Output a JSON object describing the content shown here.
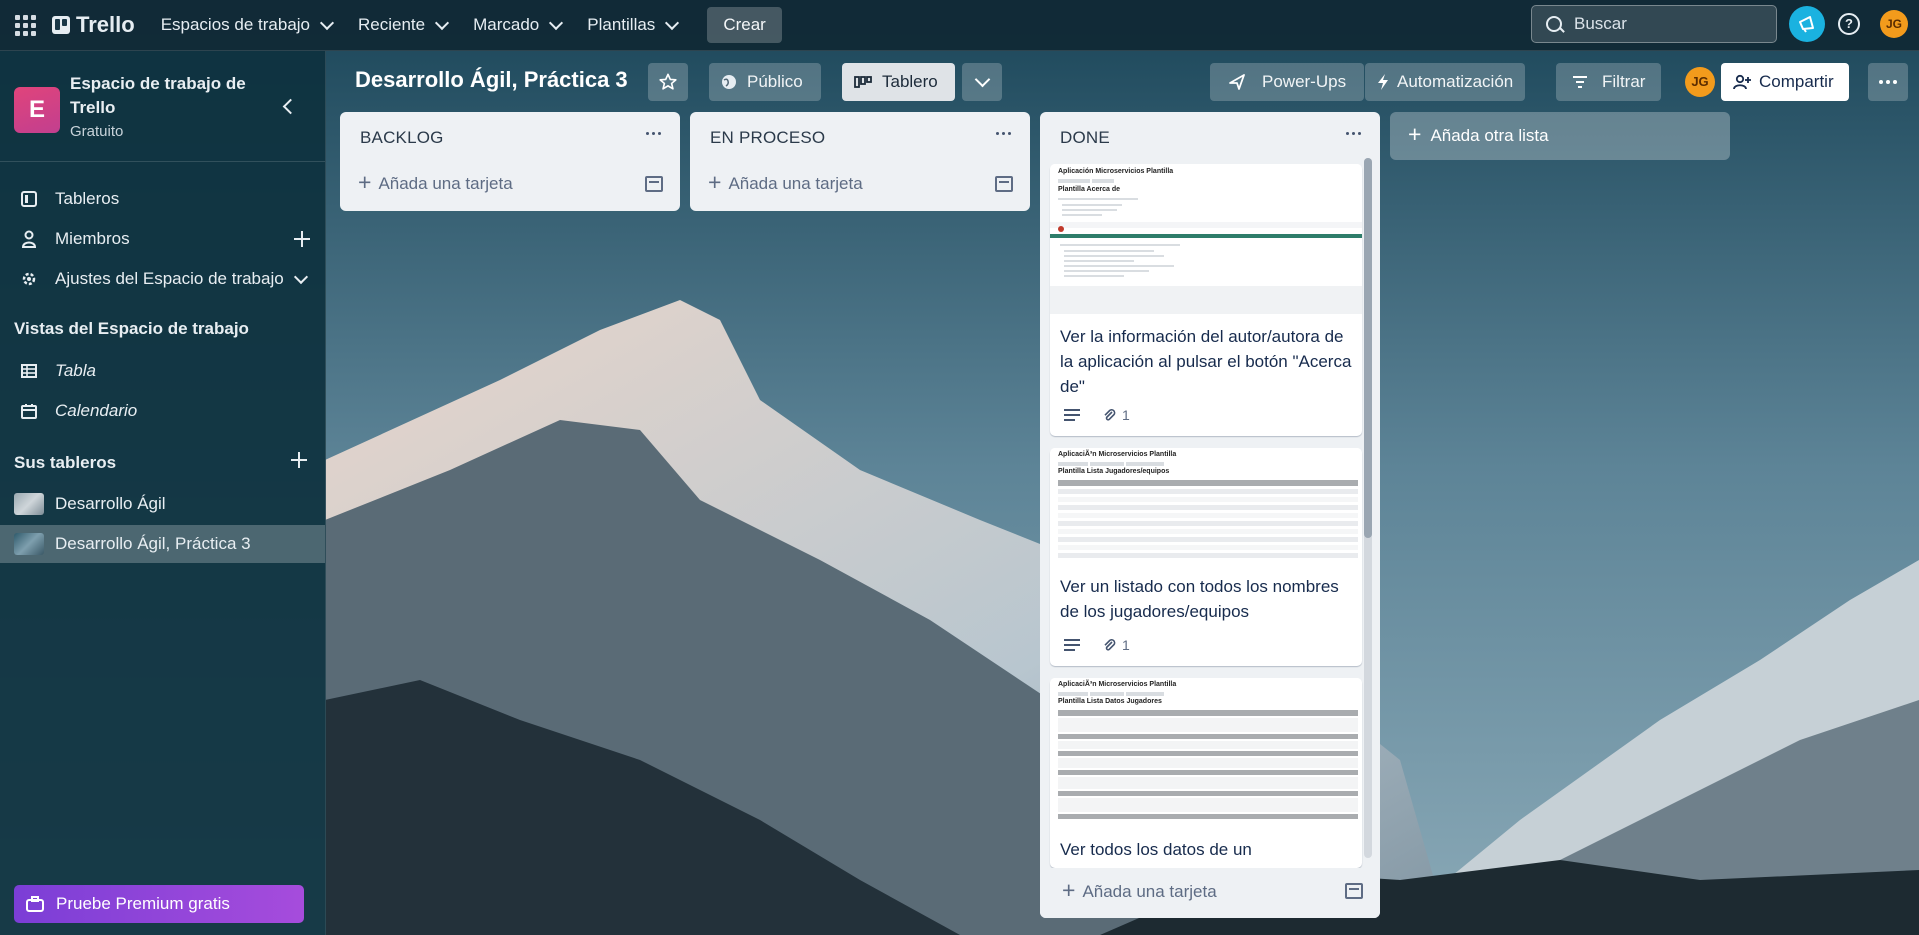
{
  "colors": {
    "topbar": "#102834",
    "sidebar": "#0e323e",
    "accent_avatar": "#f39b1c",
    "premium": "#8a44d8",
    "notification": "#1ab2e0"
  },
  "topnav": {
    "brand": "Trello",
    "menus": [
      {
        "label": "Espacios de trabajo"
      },
      {
        "label": "Reciente"
      },
      {
        "label": "Marcado"
      },
      {
        "label": "Plantillas"
      }
    ],
    "create_label": "Crear",
    "search_placeholder": "Buscar",
    "help_glyph": "?",
    "avatar_initials": "JG"
  },
  "sidebar": {
    "workspace_initial": "E",
    "workspace_name": "Espacio de trabajo de Trello",
    "workspace_plan": "Gratuito",
    "nav": [
      {
        "label": "Tableros",
        "icon": "board-icon"
      },
      {
        "label": "Miembros",
        "icon": "person-icon"
      },
      {
        "label": "Ajustes del Espacio de trabajo",
        "icon": "gear-icon"
      }
    ],
    "views_heading": "Vistas del Espacio de trabajo",
    "views": [
      {
        "label": "Tabla",
        "icon": "table-icon"
      },
      {
        "label": "Calendario",
        "icon": "calendar-icon"
      }
    ],
    "boards_heading": "Sus tableros",
    "boards": [
      {
        "label": "Desarrollo Ágil"
      },
      {
        "label": "Desarrollo Ágil, Práctica 3",
        "selected": true
      }
    ],
    "premium_label": "Pruebe Premium gratis"
  },
  "board": {
    "title": "Desarrollo Ágil, Práctica 3",
    "visibility_label": "Público",
    "view_label": "Tablero",
    "powerups_label": "Power-Ups",
    "automation_label": "Automatización",
    "filter_label": "Filtrar",
    "member_initials": "JG",
    "share_label": "Compartir"
  },
  "lists": [
    {
      "title": "BACKLOG",
      "add_card_label": "Añada una tarjeta",
      "cards": []
    },
    {
      "title": "EN PROCESO",
      "add_card_label": "Añada una tarjeta",
      "cards": []
    },
    {
      "title": "DONE",
      "add_card_label": "Añada una tarjeta",
      "cards": [
        {
          "title": "Ver la información del autor/autora de la aplicación al pulsar el botón \"Acerca de\"",
          "attachments": "1",
          "cover": {
            "app_title": "Aplicación Microservicios Plantilla",
            "page_title": "Plantilla Acerca de"
          }
        },
        {
          "title": "Ver un listado con todos los nombres de los jugadores/equipos",
          "attachments": "1",
          "cover": {
            "app_title": "AplicaciÃ³n Microservicios Plantilla",
            "page_title": "Plantilla Lista Jugadores/equipos"
          }
        },
        {
          "title": "Ver todos los datos de un",
          "attachments": "",
          "cover": {
            "app_title": "AplicaciÃ³n Microservicios Plantilla",
            "page_title": "Plantilla Lista Datos Jugadores"
          }
        }
      ]
    }
  ],
  "add_list_label": "Añada otra lista"
}
